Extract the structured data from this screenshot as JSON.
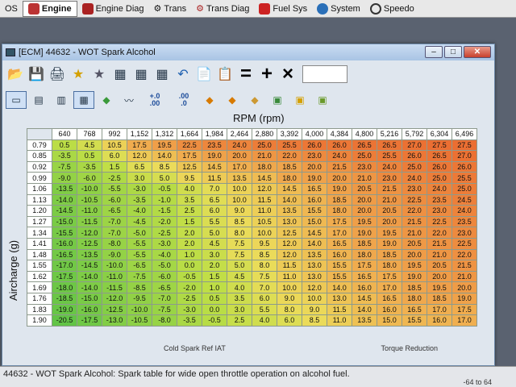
{
  "topnav": {
    "tabs": [
      {
        "label": "OS",
        "icon": "os-icon",
        "active": false
      },
      {
        "label": "Engine",
        "icon": "engine-icon",
        "active": true
      },
      {
        "label": "Engine Diag",
        "icon": "engine-diag-icon",
        "active": false
      },
      {
        "label": "Trans",
        "icon": "gear-icon",
        "active": false
      },
      {
        "label": "Trans Diag",
        "icon": "trans-diag-icon",
        "active": false
      },
      {
        "label": "Fuel Sys",
        "icon": "fuel-icon",
        "active": false
      },
      {
        "label": "System",
        "icon": "globe-icon",
        "active": false
      },
      {
        "label": "Speedo",
        "icon": "speedo-icon",
        "active": false
      }
    ]
  },
  "window": {
    "title": "[ECM] 44632 - WOT Spark Alcohol"
  },
  "table": {
    "x_axis_label": "RPM (rpm)",
    "y_axis_label": "Aircharge (g)",
    "columns": [
      "640",
      "768",
      "992",
      "1,152",
      "1,312",
      "1,664",
      "1,984",
      "2,464",
      "2,880",
      "3,392",
      "4,000",
      "4,384",
      "4,800",
      "5,216",
      "5,792",
      "6,304",
      "6,496"
    ],
    "rows": [
      {
        "h": "0.79",
        "v": [
          "0.5",
          "4.5",
          "10.5",
          "17.5",
          "19.5",
          "22.5",
          "23.5",
          "24.0",
          "25.0",
          "25.5",
          "26.0",
          "26.0",
          "26.5",
          "26.5",
          "27.0",
          "27.5",
          "27.5"
        ]
      },
      {
        "h": "0.85",
        "v": [
          "-3.5",
          "0.5",
          "6.0",
          "12.0",
          "14.0",
          "17.5",
          "19.0",
          "20.0",
          "21.0",
          "22.0",
          "23.0",
          "24.0",
          "25.0",
          "25.5",
          "26.0",
          "26.5",
          "27.0"
        ]
      },
      {
        "h": "0.92",
        "v": [
          "-7.5",
          "-3.5",
          "1.5",
          "6.5",
          "8.5",
          "12.5",
          "14.5",
          "17.0",
          "18.0",
          "18.5",
          "20.0",
          "21.5",
          "23.0",
          "24.0",
          "25.0",
          "26.0",
          "26.0"
        ]
      },
      {
        "h": "0.99",
        "v": [
          "-9.0",
          "-6.0",
          "-2.5",
          "3.0",
          "5.0",
          "9.5",
          "11.5",
          "13.5",
          "14.5",
          "18.0",
          "19.0",
          "20.0",
          "21.0",
          "23.0",
          "24.0",
          "25.0",
          "25.5"
        ]
      },
      {
        "h": "1.06",
        "v": [
          "-13.5",
          "-10.0",
          "-5.5",
          "-3.0",
          "-0.5",
          "4.0",
          "7.0",
          "10.0",
          "12.0",
          "14.5",
          "16.5",
          "19.0",
          "20.5",
          "21.5",
          "23.0",
          "24.0",
          "25.0"
        ]
      },
      {
        "h": "1.13",
        "v": [
          "-14.0",
          "-10.5",
          "-6.0",
          "-3.5",
          "-1.0",
          "3.5",
          "6.5",
          "10.0",
          "11.5",
          "14.0",
          "16.0",
          "18.5",
          "20.0",
          "21.0",
          "22.5",
          "23.5",
          "24.5"
        ]
      },
      {
        "h": "1.20",
        "v": [
          "-14.5",
          "-11.0",
          "-6.5",
          "-4.0",
          "-1.5",
          "2.5",
          "6.0",
          "9.0",
          "11.0",
          "13.5",
          "15.5",
          "18.0",
          "20.0",
          "20.5",
          "22.0",
          "23.0",
          "24.0"
        ]
      },
      {
        "h": "1.27",
        "v": [
          "-15.0",
          "-11.5",
          "-7.0",
          "-4.5",
          "-2.0",
          "1.5",
          "5.5",
          "8.5",
          "10.5",
          "13.0",
          "15.0",
          "17.5",
          "19.5",
          "20.0",
          "21.5",
          "22.5",
          "23.5"
        ]
      },
      {
        "h": "1.34",
        "v": [
          "-15.5",
          "-12.0",
          "-7.0",
          "-5.0",
          "-2.5",
          "2.0",
          "5.0",
          "8.0",
          "10.0",
          "12.5",
          "14.5",
          "17.0",
          "19.0",
          "19.5",
          "21.0",
          "22.0",
          "23.0"
        ]
      },
      {
        "h": "1.41",
        "v": [
          "-16.0",
          "-12.5",
          "-8.0",
          "-5.5",
          "-3.0",
          "2.0",
          "4.5",
          "7.5",
          "9.5",
          "12.0",
          "14.0",
          "16.5",
          "18.5",
          "19.0",
          "20.5",
          "21.5",
          "22.5"
        ]
      },
      {
        "h": "1.48",
        "v": [
          "-16.5",
          "-13.5",
          "-9.0",
          "-5.5",
          "-4.0",
          "1.0",
          "3.0",
          "7.5",
          "8.5",
          "12.0",
          "13.5",
          "16.0",
          "18.0",
          "18.5",
          "20.0",
          "21.0",
          "22.0"
        ]
      },
      {
        "h": "1.55",
        "v": [
          "-17.0",
          "-14.5",
          "-10.0",
          "-6.5",
          "-5.0",
          "0.0",
          "2.0",
          "5.0",
          "8.0",
          "11.5",
          "13.0",
          "15.5",
          "17.5",
          "18.0",
          "19.5",
          "20.5",
          "21.5"
        ]
      },
      {
        "h": "1.62",
        "v": [
          "-17.5",
          "-14.0",
          "-11.0",
          "-7.5",
          "-6.0",
          "-0.5",
          "1.5",
          "4.5",
          "7.5",
          "11.0",
          "13.0",
          "15.5",
          "16.5",
          "17.5",
          "19.0",
          "20.0",
          "21.0"
        ]
      },
      {
        "h": "1.69",
        "v": [
          "-18.0",
          "-14.0",
          "-11.5",
          "-8.5",
          "-6.5",
          "-2.0",
          "1.0",
          "4.0",
          "7.0",
          "10.0",
          "12.0",
          "14.0",
          "16.0",
          "17.0",
          "18.5",
          "19.5",
          "20.0"
        ]
      },
      {
        "h": "1.76",
        "v": [
          "-18.5",
          "-15.0",
          "-12.0",
          "-9.5",
          "-7.0",
          "-2.5",
          "0.5",
          "3.5",
          "6.0",
          "9.0",
          "10.0",
          "13.0",
          "14.5",
          "16.5",
          "18.0",
          "18.5",
          "19.0"
        ]
      },
      {
        "h": "1.83",
        "v": [
          "-19.0",
          "-16.0",
          "-12.5",
          "-10.0",
          "-7.5",
          "-3.0",
          "0.0",
          "3.0",
          "5.5",
          "8.0",
          "9.0",
          "11.5",
          "14.0",
          "16.0",
          "16.5",
          "17.0",
          "17.5"
        ]
      },
      {
        "h": "1.90",
        "v": [
          "-20.5",
          "-17.5",
          "-13.0",
          "-10.5",
          "-8.0",
          "-3.5",
          "-0.5",
          "2.5",
          "4.0",
          "6.0",
          "8.5",
          "11.0",
          "13.5",
          "15.0",
          "15.5",
          "16.0",
          "17.0"
        ]
      }
    ]
  },
  "bottom_labels": {
    "left": "Cold Spark Ref IAT",
    "right": "Torque Reduction"
  },
  "status": {
    "text": "44632 - WOT Spark Alcohol: Spark table for wide open throttle operation on alcohol fuel.",
    "range": "-64 to 64"
  }
}
